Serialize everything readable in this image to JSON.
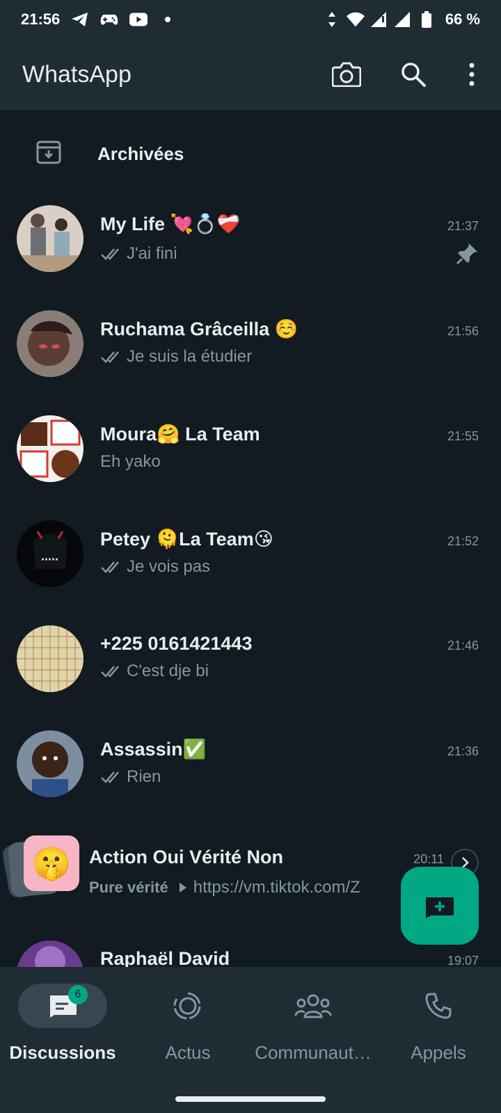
{
  "status_bar": {
    "time": "21:56",
    "battery": "66 %"
  },
  "app_bar": {
    "title": "WhatsApp"
  },
  "archived": {
    "label": "Archivées"
  },
  "chats": [
    {
      "name": "My Life 💘💍❤️‍🩹",
      "time": "21:37",
      "preview": "J'ai fini",
      "ticks": true,
      "pinned": true,
      "avatar_color": "#b9a48f"
    },
    {
      "name": "Ruchama Grâceilla ☺️",
      "time": "21:56",
      "preview": "Je suis la étudier",
      "ticks": true,
      "avatar_color": "#7a6b66"
    },
    {
      "name": "Moura🤗 La Team",
      "time": "21:55",
      "preview": "Eh yako",
      "ticks": false,
      "avatar_color": "#8b4b2a"
    },
    {
      "name": "Petey 🫠La Team😘",
      "time": "21:52",
      "preview": "Je vois pas",
      "ticks": true,
      "avatar_color": "#0d0f12"
    },
    {
      "name": "+225 0161421443",
      "time": "21:46",
      "preview": "C'est dje bi",
      "ticks": true,
      "avatar_color": "#d8c79e"
    },
    {
      "name": "Assassin✅",
      "time": "21:36",
      "preview": "Rien",
      "ticks": true,
      "avatar_color": "#6b7f93"
    },
    {
      "name": "Action Oui Vérité Non",
      "time": "20:11",
      "preview_bold": "Pure vérité",
      "preview": "https://vm.tiktok.com/Z",
      "ticks": false,
      "avatar_emoji": "🤫"
    },
    {
      "name": "Raphaël David",
      "time": "19:07",
      "preview": "",
      "ticks": false,
      "avatar_color": "#6a3b8c"
    }
  ],
  "nav": {
    "items": [
      {
        "label": "Discussions",
        "badge": "6"
      },
      {
        "label": "Actus"
      },
      {
        "label": "Communaut…"
      },
      {
        "label": "Appels"
      }
    ]
  },
  "colors": {
    "accent": "#00a884",
    "bg": "#111b21",
    "bar": "#202c33"
  }
}
